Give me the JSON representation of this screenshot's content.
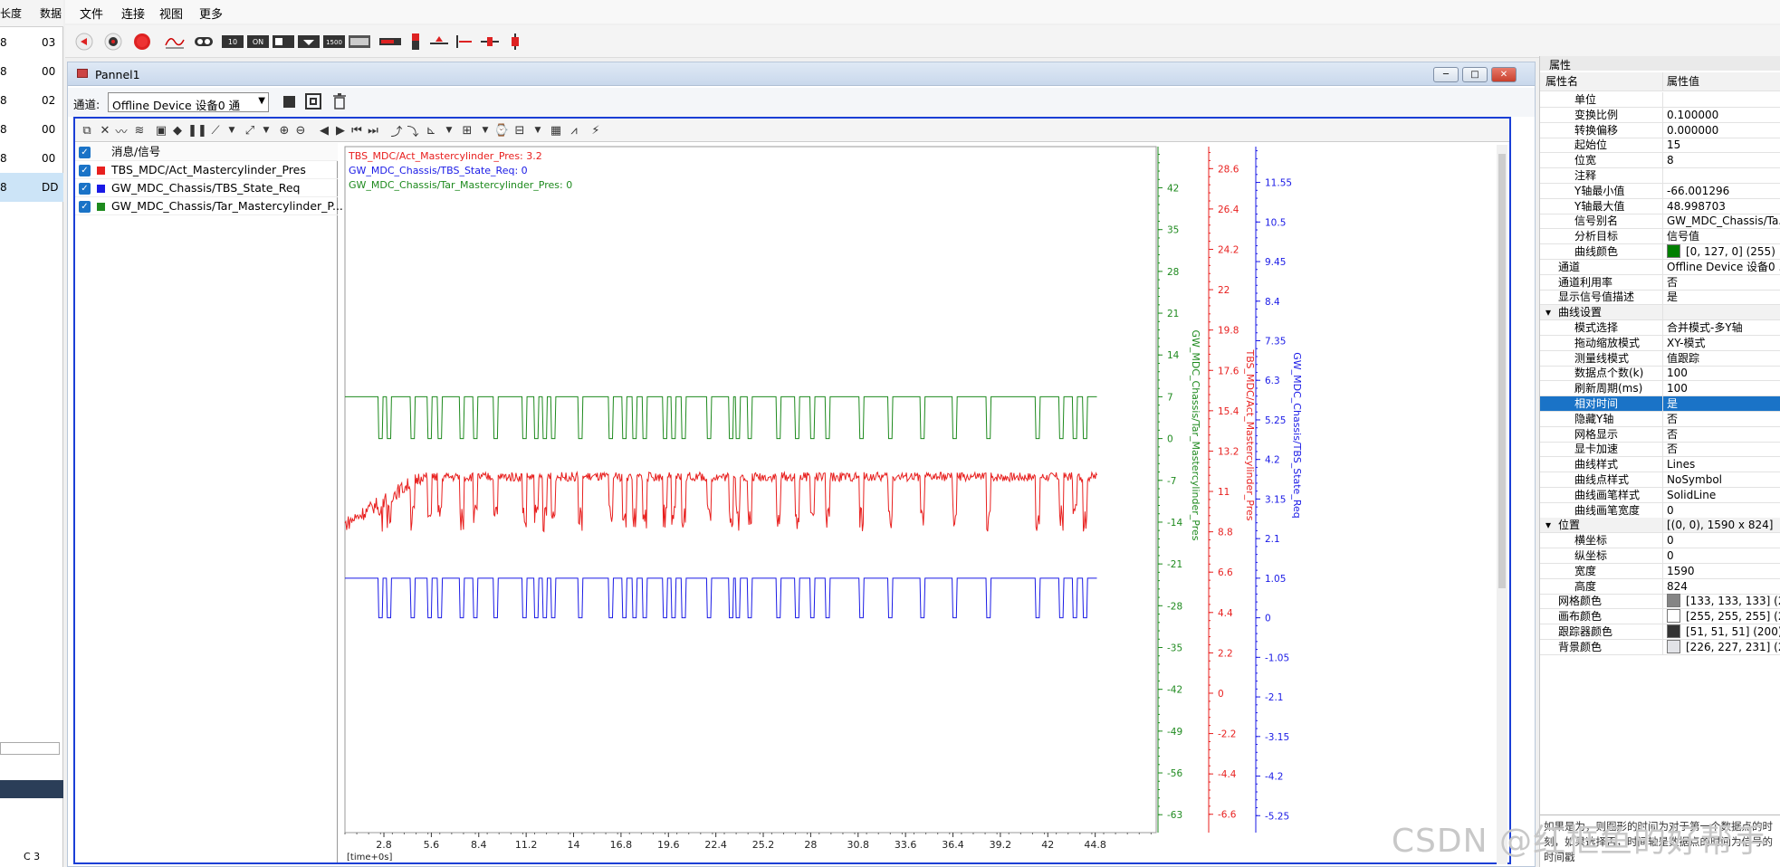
{
  "left_list": {
    "headers": [
      "长度",
      "数据"
    ],
    "rows": [
      {
        "a": "8",
        "b": "03",
        "selected": false
      },
      {
        "a": "8",
        "b": "00",
        "selected": false
      },
      {
        "a": "8",
        "b": "02",
        "selected": false
      },
      {
        "a": "8",
        "b": "00",
        "selected": false
      },
      {
        "a": "8",
        "b": "00",
        "selected": false
      },
      {
        "a": "8",
        "b": "DD",
        "selected": true
      }
    ],
    "footer_label": "C 3"
  },
  "menu": [
    "文件",
    "连接",
    "视图",
    "更多"
  ],
  "toolbar_icons": [
    "back-icon",
    "record-icon",
    "stop-icon",
    "waveform-icon",
    "link-icon",
    "box-10-icon",
    "box-on-icon",
    "box-1-icon",
    "box-arrow-icon",
    "box-1500-icon",
    "box-num-icon",
    "red-bar-icon",
    "red-marker-icon",
    "baseline-icon",
    "arrow-line-icon",
    "cursor-icon",
    "split-icon"
  ],
  "panel": {
    "title": "Pannel1",
    "channel_label": "通道:",
    "channel_value": "Offline Device 设备0 通",
    "window_buttons": {
      "min": "─",
      "max": "□",
      "close": "✕"
    }
  },
  "signal_list": {
    "header": "消息/信号",
    "rows": [
      {
        "name": "TBS_MDC/Act_Mastercylinder_Pres",
        "color": "#e8201f"
      },
      {
        "name": "GW_MDC_Chassis/TBS_State_Req",
        "color": "#1a1ae6"
      },
      {
        "name": "GW_MDC_Chassis/Tar_Mastercylinder_P...",
        "color": "#1e8a1e"
      }
    ]
  },
  "chart_data": {
    "type": "line",
    "legend": [
      {
        "text": "TBS_MDC/Act_Mastercylinder_Pres: 3.2",
        "color": "#e8201f"
      },
      {
        "text": "GW_MDC_Chassis/TBS_State_Req: 0",
        "color": "#1a1ae6"
      },
      {
        "text": "GW_MDC_Chassis/Tar_Mastercylinder_Pres: 0",
        "color": "#1e8a1e"
      }
    ],
    "x_ticks": [
      "2.8",
      "5.6",
      "8.4",
      "11.2",
      "14",
      "16.8",
      "19.6",
      "22.4",
      "25.2",
      "28",
      "30.8",
      "33.6",
      "36.4",
      "39.2",
      "42",
      "44.8"
    ],
    "x_label": "[time+0s]",
    "xlim": [
      0.5,
      48.4
    ],
    "y_axes": [
      {
        "name": "GW_MDC_Chassis/Tar_Mastercylinder_Pres",
        "color": "#1e8a1e",
        "ticks": [
          "42",
          "35",
          "28",
          "21",
          "14",
          "7",
          "0",
          "-7",
          "-14",
          "-21",
          "-28",
          "-35",
          "-42",
          "-49",
          "-56",
          "-63"
        ],
        "ylim": [
          -66,
          48.9
        ]
      },
      {
        "name": "TBS_MDC/Act_Mastercylinder_Pres",
        "color": "#e8201f",
        "ticks": [
          "28.6",
          "26.4",
          "24.2",
          "22",
          "19.8",
          "17.6",
          "15.4",
          "13.2",
          "11",
          "8.8",
          "6.6",
          "4.4",
          "2.2",
          "0",
          "-2.2",
          "-4.4",
          "-6.6"
        ],
        "ylim": [
          -7.6,
          29.8
        ]
      },
      {
        "name": "GW_MDC_Chassis/TBS_State_Req",
        "color": "#1a1ae6",
        "ticks": [
          "11.55",
          "10.5",
          "9.45",
          "8.4",
          "7.35",
          "6.3",
          "5.25",
          "4.2",
          "3.15",
          "2.1",
          "1.05",
          "0",
          "-1.05",
          "-2.1",
          "-3.15",
          "-4.2",
          "-5.25"
        ],
        "ylim": [
          -5.7,
          12.5
        ]
      }
    ],
    "series": [
      {
        "name": "GW_MDC_Chassis/Tar_Mastercylinder_Pres",
        "axis": 0,
        "color": "#1e8a1e",
        "base": 7,
        "low": 0,
        "x_start": 0.5,
        "x_end": 44.9,
        "dips": [
          2.6,
          3.1,
          4.5,
          5.5,
          6.1,
          7.4,
          8.2,
          9.4,
          11.1,
          11.8,
          12.3,
          12.8,
          14.4,
          16.2,
          17.0,
          17.6,
          18.2,
          19.4,
          19.9,
          20.5,
          22.0,
          23.3,
          23.7,
          24.4,
          26.1,
          27.2,
          28.1,
          29.0,
          31.0,
          32.7,
          34.6,
          36.5,
          38.5,
          41.4,
          42.8,
          43.6,
          44.2
        ]
      },
      {
        "name": "TBS_MDC/Act_Mastercylinder_Pres",
        "axis": 1,
        "color": "#e8201f",
        "base": 11.8,
        "low": 8.8,
        "start": 9.2,
        "ramp_end": 5.0,
        "x_start": 0.5,
        "x_end": 44.9,
        "dips": [
          2.6,
          3.1,
          4.5,
          5.5,
          6.1,
          7.4,
          8.2,
          9.4,
          11.1,
          11.8,
          12.3,
          12.8,
          14.4,
          16.2,
          17.0,
          17.6,
          18.2,
          19.4,
          19.9,
          20.5,
          22.0,
          23.3,
          23.7,
          24.4,
          26.1,
          27.2,
          28.1,
          29.0,
          31.0,
          32.7,
          34.6,
          36.5,
          38.5,
          41.4,
          42.8,
          43.6,
          44.2
        ]
      },
      {
        "name": "GW_MDC_Chassis/TBS_State_Req",
        "axis": 2,
        "color": "#1a1ae6",
        "base": 1.05,
        "low": 0,
        "x_start": 0.5,
        "x_end": 44.9,
        "dips": [
          2.6,
          3.1,
          4.5,
          5.5,
          6.1,
          7.4,
          8.2,
          9.4,
          11.1,
          11.8,
          12.3,
          12.8,
          14.4,
          16.2,
          17.0,
          17.6,
          18.2,
          19.4,
          19.9,
          20.5,
          22.0,
          23.3,
          23.7,
          24.4,
          26.1,
          27.2,
          28.1,
          29.0,
          31.0,
          32.7,
          34.6,
          36.5,
          38.5,
          41.4,
          42.8,
          43.6,
          44.2
        ]
      }
    ]
  },
  "properties": {
    "title": "属性",
    "col_name": "属性名",
    "col_value": "属性值",
    "rows": [
      {
        "k": "单位",
        "v": "",
        "indent": 2
      },
      {
        "k": "变换比例",
        "v": "0.100000",
        "indent": 2
      },
      {
        "k": "转换偏移",
        "v": "0.000000",
        "indent": 2
      },
      {
        "k": "起始位",
        "v": "15",
        "indent": 2
      },
      {
        "k": "位宽",
        "v": "8",
        "indent": 2
      },
      {
        "k": "注释",
        "v": "",
        "indent": 2
      },
      {
        "k": "Y轴最小值",
        "v": "-66.001296",
        "indent": 2
      },
      {
        "k": "Y轴最大值",
        "v": "48.998703",
        "indent": 2
      },
      {
        "k": "信号别名",
        "v": "GW_MDC_Chassis/Ta...",
        "indent": 2
      },
      {
        "k": "分析目标",
        "v": "信号值",
        "indent": 2
      },
      {
        "k": "曲线颜色",
        "v": "[0, 127, 0] (255)",
        "indent": 2,
        "swatch": "#007f00"
      },
      {
        "k": "通道",
        "v": "Offline Device 设备0 ...",
        "indent": 1
      },
      {
        "k": "通道利用率",
        "v": "否",
        "indent": 1
      },
      {
        "k": "显示信号值描述",
        "v": "是",
        "indent": 1
      },
      {
        "k": "曲线设置",
        "v": "",
        "indent": 0,
        "section": true
      },
      {
        "k": "模式选择",
        "v": "合并模式-多Y轴",
        "indent": 2
      },
      {
        "k": "拖动缩放模式",
        "v": "XY-模式",
        "indent": 2
      },
      {
        "k": "测量线模式",
        "v": "值跟踪",
        "indent": 2
      },
      {
        "k": "数据点个数(k)",
        "v": "100",
        "indent": 2
      },
      {
        "k": "刷新周期(ms)",
        "v": "100",
        "indent": 2
      },
      {
        "k": "相对时间",
        "v": "是",
        "indent": 2,
        "selected": true
      },
      {
        "k": "隐藏Y轴",
        "v": "否",
        "indent": 2
      },
      {
        "k": "网格显示",
        "v": "否",
        "indent": 2
      },
      {
        "k": "显卡加速",
        "v": "否",
        "indent": 2
      },
      {
        "k": "曲线样式",
        "v": "Lines",
        "indent": 2
      },
      {
        "k": "曲线点样式",
        "v": "NoSymbol",
        "indent": 2
      },
      {
        "k": "曲线画笔样式",
        "v": "SolidLine",
        "indent": 2
      },
      {
        "k": "曲线画笔宽度",
        "v": "0",
        "indent": 2
      },
      {
        "k": "位置",
        "v": "[(0, 0), 1590 x 824]",
        "indent": 0,
        "section": true
      },
      {
        "k": "横坐标",
        "v": "0",
        "indent": 2
      },
      {
        "k": "纵坐标",
        "v": "0",
        "indent": 2
      },
      {
        "k": "宽度",
        "v": "1590",
        "indent": 2
      },
      {
        "k": "高度",
        "v": "824",
        "indent": 2
      },
      {
        "k": "网格颜色",
        "v": "[133, 133, 133] (2...",
        "indent": 1,
        "swatch": "#858585"
      },
      {
        "k": "画布颜色",
        "v": "[255, 255, 255] (2...",
        "indent": 1,
        "swatch": "#ffffff"
      },
      {
        "k": "跟踪器颜色",
        "v": "[51, 51, 51] (200)",
        "indent": 1,
        "swatch": "#333333"
      },
      {
        "k": "背景颜色",
        "v": "[226, 227, 231] (2...",
        "indent": 1,
        "swatch": "#e2e3e7"
      }
    ],
    "description": "如果是为，则图形的时间为对于第一个数据点的时刻，如果选择否，时间轴是数据点的时间为信号的时间戳"
  },
  "watermark": "CSDN @红框鱼的好帮手"
}
